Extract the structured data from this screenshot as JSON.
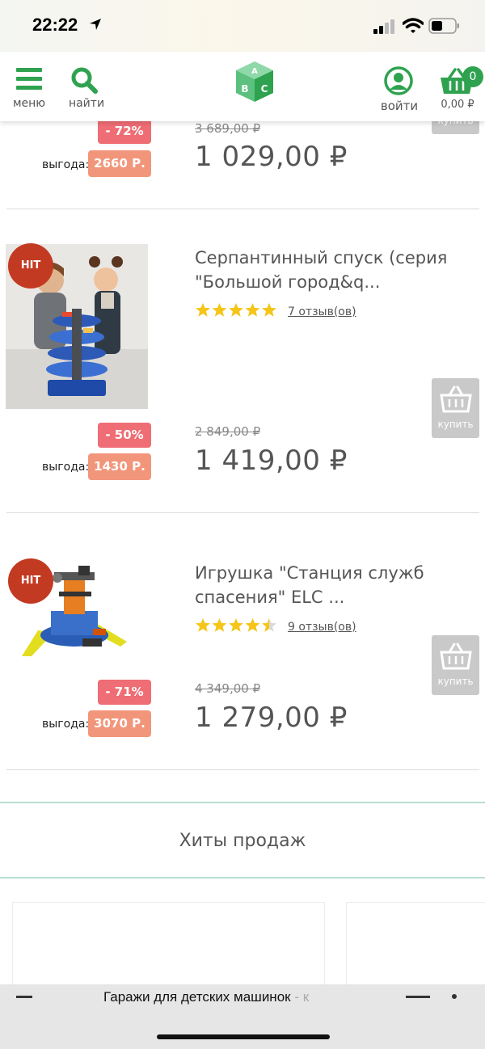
{
  "status_bar": {
    "time": "22:22"
  },
  "header": {
    "menu_label": "меню",
    "search_label": "найти",
    "login_label": "войти",
    "cart_count": "0",
    "cart_total": "0,00 ₽",
    "logo_letters": [
      "A",
      "B",
      "C"
    ]
  },
  "colors": {
    "brand_green": "#2fa24f",
    "discount_red": "#ef6d74",
    "gain_orange": "#f2967b",
    "hit_red": "#c33a22",
    "star_gold": "#f5c518"
  },
  "products": [
    {
      "old_price": "3 689,00 ₽",
      "price": "1 029,00 ₽",
      "discount": "- 72%",
      "gain_label": "выгода:",
      "gain": "2660 Р.",
      "buy_label": "купить"
    },
    {
      "badge": "HIT",
      "name": "Серпантинный спуск (серия \"Большой город&q...",
      "rating": 5,
      "reviews": "7 отзыв(ов)",
      "old_price": "2 849,00 ₽",
      "price": "1 419,00 ₽",
      "discount": "- 50%",
      "gain_label": "выгода:",
      "gain": "1430 Р.",
      "buy_label": "купить"
    },
    {
      "badge": "HIT",
      "name": "Игрушка \"Станция служб спасения\" ELC ...",
      "rating": 4.5,
      "reviews": "9 отзыв(ов)",
      "old_price": "4 349,00 ₽",
      "price": "1 279,00 ₽",
      "discount": "- 71%",
      "gain_label": "выгода:",
      "gain": "3070 Р.",
      "buy_label": "купить"
    }
  ],
  "section": {
    "title": "Хиты продаж"
  },
  "browser_bar": {
    "page_title": "Гаражи для детских машинок",
    "page_title_faded": " - к"
  }
}
